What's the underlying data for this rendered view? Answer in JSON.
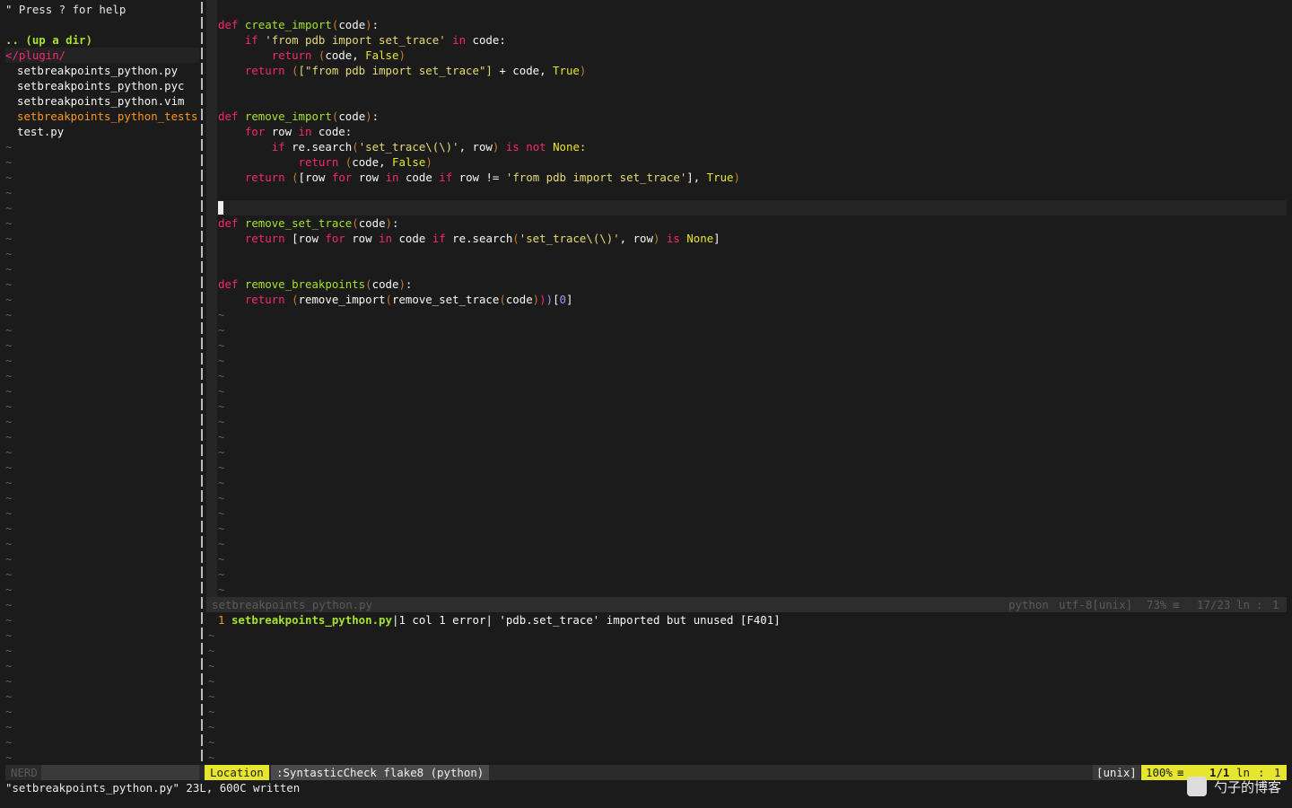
{
  "nerdtree": {
    "help": "\" Press ? for help",
    "updir": ".. (up a dir)",
    "root": "</plugin/",
    "files": [
      {
        "name": "setbreakpoints_python.py",
        "kind": "normal"
      },
      {
        "name": "setbreakpoints_python.pyc",
        "kind": "normal"
      },
      {
        "name": "setbreakpoints_python.vim",
        "kind": "normal"
      },
      {
        "name": "setbreakpoints_python_tests.p",
        "kind": "modified"
      },
      {
        "name": "test.py",
        "kind": "normal"
      }
    ],
    "tilde": "~",
    "status_label": "NERD"
  },
  "editor": {
    "code": {
      "l1_def": "def",
      "l1_name": "create_import",
      "l1_arg": "code",
      "l2_if": "if",
      "l2_str": "'from pdb import set_trace'",
      "l2_in": "in",
      "l2_code": "code:",
      "l3_return": "return",
      "l3_body": "code,",
      "l3_false": "False",
      "l4_return": "return",
      "l4_list": "[\"from pdb import set_trace\"]",
      "l4_plus": " + code, ",
      "l4_true": "True",
      "l5_def": "def",
      "l5_name": "remove_import",
      "l5_arg": "code",
      "l6_for": "for",
      "l6_row": " row ",
      "l6_in": "in",
      "l6_code": " code:",
      "l7_if": "if",
      "l7_re": " re.search",
      "l7_str": "'set_trace\\(\\)'",
      "l7_row": ", row",
      "l7_is": "is",
      "l7_not": "not",
      "l7_none": "None:",
      "l8_return": "return",
      "l8_body": "code,",
      "l8_false": "False",
      "l9_return": "return",
      "l9_a": "[row ",
      "l9_for": "for",
      "l9_b": " row ",
      "l9_in": "in",
      "l9_c": " code ",
      "l9_if": "if",
      "l9_d": " row != ",
      "l9_str": "'from pdb import set_trace'",
      "l9_e": "], ",
      "l9_true": "True",
      "l10_def": "def",
      "l10_name": "remove_set_trace",
      "l10_arg": "code",
      "l11_return": "return",
      "l11_a": " [row ",
      "l11_for": "for",
      "l11_b": " row ",
      "l11_in": "in",
      "l11_c": " code ",
      "l11_if": "if",
      "l11_d": " re.search",
      "l11_str": "'set_trace\\(\\)'",
      "l11_e": ", row",
      "l11_is": "is",
      "l11_none": "None",
      "l12_def": "def",
      "l12_name": "remove_breakpoints",
      "l12_arg": "code",
      "l13_return": "return",
      "l13_a": "remove_import",
      "l13_b": "remove_set_trace",
      "l13_c": "code",
      "l13_idx": "0"
    },
    "tilde": "~"
  },
  "statusline_top": {
    "filename": "setbreakpoints_python.py",
    "filetype": "python",
    "encoding": "utf-8[unix]",
    "percent": "73%",
    "position": "17/23",
    "ln": "ln",
    "col": "1"
  },
  "quickfix": {
    "num": "1",
    "file": "setbreakpoints_python.py",
    "loc": "1 col 1",
    "type": "error",
    "message": "'pdb.set_trace' imported but unused [F401]"
  },
  "statusline_bottom": {
    "mode": "Location",
    "title": ":SyntasticCheck flake8 (python)",
    "format": "[unix]",
    "percent": "100%",
    "position": "1/1",
    "ln": "ln",
    "col": "1"
  },
  "cmdline": {
    "message": "\"setbreakpoints_python.py\" 23L, 600C written"
  },
  "watermark": {
    "text": "勺子的博客"
  }
}
